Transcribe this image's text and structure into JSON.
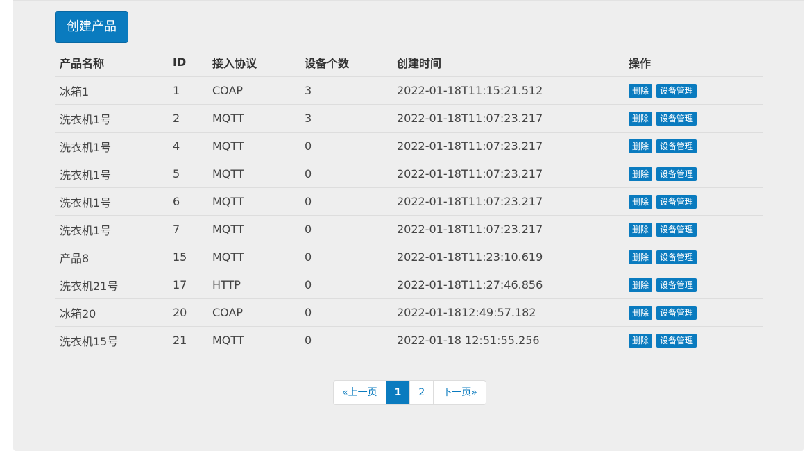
{
  "toolbar": {
    "create_label": "创建产品"
  },
  "table": {
    "headers": {
      "name": "产品名称",
      "id": "ID",
      "protocol": "接入协议",
      "device_count": "设备个数",
      "created_at": "创建时间",
      "actions": "操作"
    },
    "rows": [
      {
        "name": "冰箱1",
        "id": "1",
        "protocol": "COAP",
        "device_count": "3",
        "created_at": "2022-01-18T11:15:21.512",
        "delete": "删除",
        "manage": "设备管理"
      },
      {
        "name": "洗衣机1号",
        "id": "2",
        "protocol": "MQTT",
        "device_count": "3",
        "created_at": "2022-01-18T11:07:23.217",
        "delete": "删除",
        "manage": "设备管理"
      },
      {
        "name": "洗衣机1号",
        "id": "4",
        "protocol": "MQTT",
        "device_count": "0",
        "created_at": "2022-01-18T11:07:23.217",
        "delete": "删除",
        "manage": "设备管理"
      },
      {
        "name": "洗衣机1号",
        "id": "5",
        "protocol": "MQTT",
        "device_count": "0",
        "created_at": "2022-01-18T11:07:23.217",
        "delete": "删除",
        "manage": "设备管理"
      },
      {
        "name": "洗衣机1号",
        "id": "6",
        "protocol": "MQTT",
        "device_count": "0",
        "created_at": "2022-01-18T11:07:23.217",
        "delete": "删除",
        "manage": "设备管理"
      },
      {
        "name": "洗衣机1号",
        "id": "7",
        "protocol": "MQTT",
        "device_count": "0",
        "created_at": "2022-01-18T11:07:23.217",
        "delete": "删除",
        "manage": "设备管理"
      },
      {
        "name": "产品8",
        "id": "15",
        "protocol": "MQTT",
        "device_count": "0",
        "created_at": "2022-01-18T11:23:10.619",
        "delete": "删除",
        "manage": "设备管理"
      },
      {
        "name": "洗衣机21号",
        "id": "17",
        "protocol": "HTTP",
        "device_count": "0",
        "created_at": "2022-01-18T11:27:46.856",
        "delete": "删除",
        "manage": "设备管理"
      },
      {
        "name": "冰箱20",
        "id": "20",
        "protocol": "COAP",
        "device_count": "0",
        "created_at": "2022-01-1812:49:57.182",
        "delete": "删除",
        "manage": "设备管理"
      },
      {
        "name": "洗衣机15号",
        "id": "21",
        "protocol": "MQTT",
        "device_count": "0",
        "created_at": "2022-01-18 12:51:55.256",
        "delete": "删除",
        "manage": "设备管理"
      }
    ]
  },
  "pagination": {
    "prev": "«上一页",
    "pages": [
      "1",
      "2"
    ],
    "current": "1",
    "next": "下一页»"
  },
  "colors": {
    "primary": "#0a7bbf",
    "panel": "#eeeeee"
  }
}
